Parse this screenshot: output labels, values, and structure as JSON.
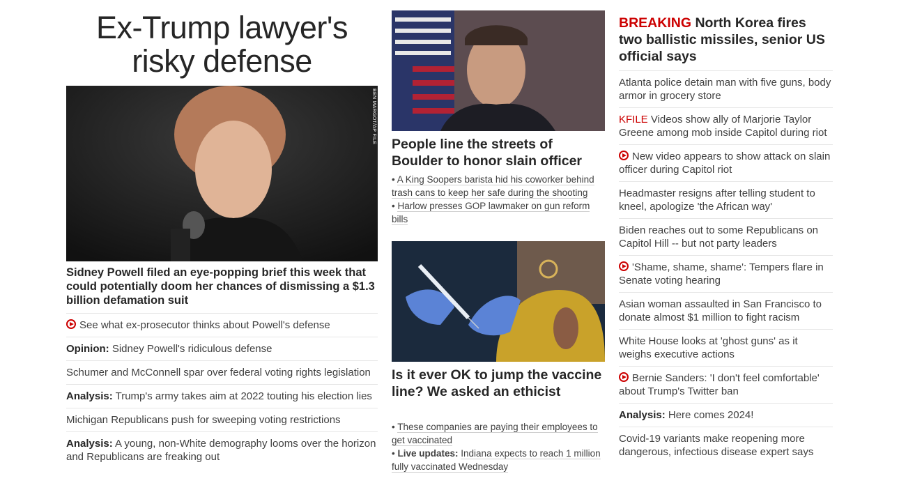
{
  "left": {
    "title_line1": "Ex-Trump lawyer's",
    "title_line2": "risky defense",
    "photo_credit": "BEN MARGOT/AP FILE",
    "hero_headline": "Sidney Powell filed an eye-popping brief this week that could potentially doom her chances of dismissing a $1.3 billion defamation suit",
    "items": [
      {
        "label": "",
        "text": "See what ex-prosecutor thinks about Powell's defense",
        "video": true
      },
      {
        "label": "Opinion:",
        "text": "Sidney Powell's ridiculous defense",
        "video": false
      },
      {
        "label": "",
        "text": "Schumer and McConnell spar over federal voting rights legislation",
        "video": false
      },
      {
        "label": "Analysis:",
        "text": "Trump's army takes aim at 2022 touting his election lies",
        "video": false
      },
      {
        "label": "",
        "text": "Michigan Republicans push for sweeping voting restrictions",
        "video": false
      },
      {
        "label": "Analysis:",
        "text": "A young, non-White demography looms over the horizon and Republicans are freaking out",
        "video": false
      }
    ]
  },
  "middle": {
    "story1_headline": "People line the streets of Boulder to honor slain officer",
    "story1_bullets": [
      "A King Soopers barista hid his coworker behind trash cans to keep her safe during the shooting",
      "Harlow presses GOP lawmaker on gun reform bills"
    ],
    "story2_headline": "Is it ever OK to jump the vaccine line? We asked an ethicist",
    "story2_bullet1": "These companies are paying their employees to get vaccinated",
    "story2_bullet2_label": "Live updates:",
    "story2_bullet2_text": "Indiana expects to reach 1 million fully vaccinated Wednesday"
  },
  "right": {
    "breaking_tag": "BREAKING",
    "breaking_text": "North Korea fires two ballistic missiles, senior US official says",
    "items": [
      {
        "label": "",
        "text": "Atlanta police detain man with five guns, body armor in grocery store",
        "video": false
      },
      {
        "label": "KFILE",
        "text": "Videos show ally of Marjorie Taylor Greene among mob inside Capitol during riot",
        "video": false
      },
      {
        "label": "",
        "text": "New video appears to show attack on slain officer during Capitol riot",
        "video": true
      },
      {
        "label": "",
        "text": "Headmaster resigns after telling student to kneel, apologize 'the African way'",
        "video": false
      },
      {
        "label": "",
        "text": "Biden reaches out to some Republicans on Capitol Hill -- but not party leaders",
        "video": false
      },
      {
        "label": "",
        "text": "'Shame, shame, shame': Tempers flare in Senate voting hearing",
        "video": true
      },
      {
        "label": "",
        "text": "Asian woman assaulted in San Francisco to donate almost $1 million to fight racism",
        "video": false
      },
      {
        "label": "",
        "text": "White House looks at 'ghost guns' as it weighs executive actions",
        "video": false
      },
      {
        "label": "",
        "text": "Bernie Sanders: 'I don't feel comfortable' about Trump's Twitter ban",
        "video": true
      },
      {
        "label": "Analysis:",
        "text": "Here comes 2024!",
        "video": false
      },
      {
        "label": "",
        "text": "Covid-19 variants make reopening more dangerous, infectious disease expert says",
        "video": false
      }
    ]
  },
  "colors": {
    "accent_red": "#cc0000",
    "text": "#262626",
    "divider": "#e6e6e6"
  }
}
